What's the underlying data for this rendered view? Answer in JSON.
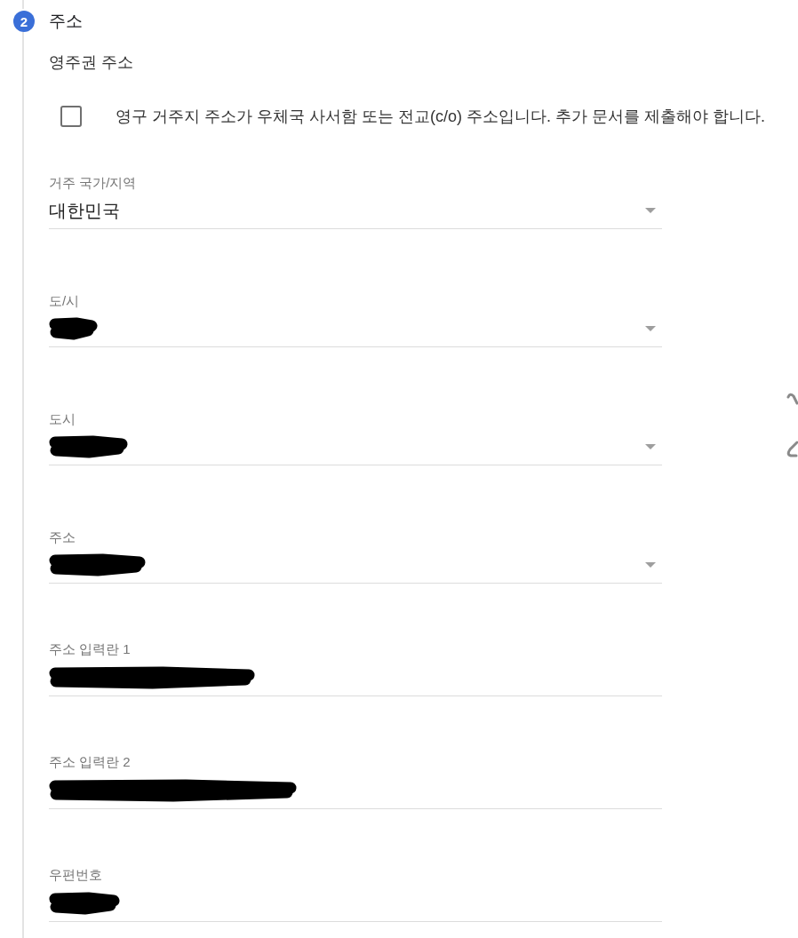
{
  "step": {
    "number": "2",
    "title": "주소"
  },
  "section": {
    "title": "영주권 주소"
  },
  "checkbox": {
    "label": "영구 거주지 주소가 우체국 사서함 또는 전교(c/o) 주소입니다. 추가 문서를 제출해야 합니다.",
    "checked": false
  },
  "fields": [
    {
      "kind": "select",
      "label": "거주 국가/지역",
      "value": "대한민국",
      "redacted": false
    },
    {
      "kind": "select",
      "label": "도/시",
      "redacted": true
    },
    {
      "kind": "select",
      "label": "도시",
      "redacted": true
    },
    {
      "kind": "select",
      "label": "주소",
      "redacted": true
    },
    {
      "kind": "text",
      "label": "주소 입력란 1",
      "redacted": true
    },
    {
      "kind": "text",
      "label": "주소 입력란 2",
      "redacted": true
    },
    {
      "kind": "text",
      "label": "우편번호",
      "redacted": true
    }
  ]
}
